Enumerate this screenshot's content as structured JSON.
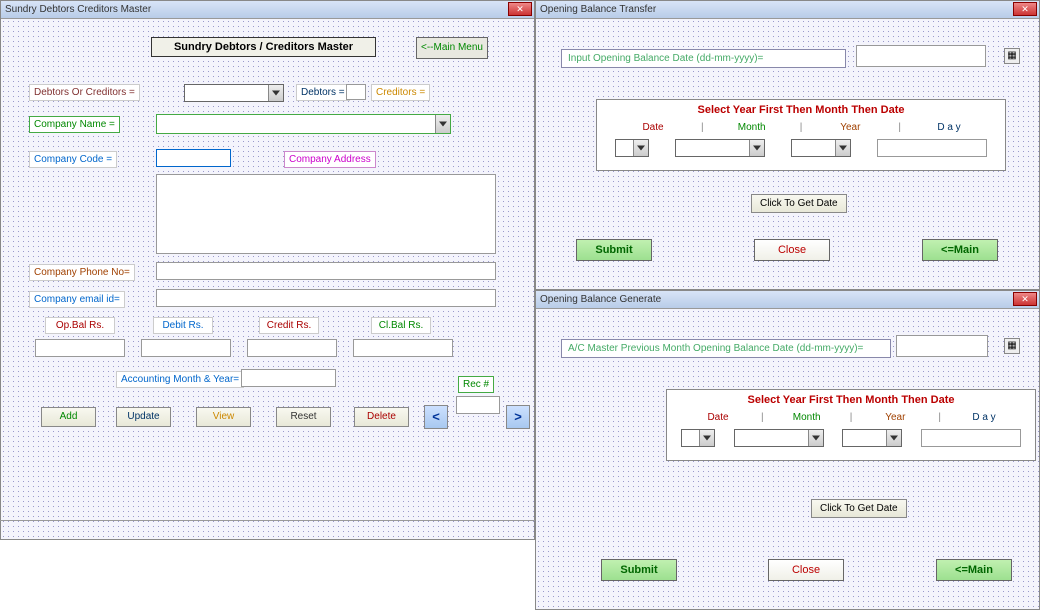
{
  "w1": {
    "title_bar": "Sundry Debtors Creditors  Master",
    "header": "Sundry Debtors / Creditors Master",
    "main_menu": "<--Main Menu",
    "debtors_or_creditors": "Debtors Or Creditors =",
    "debtors": "Debtors =",
    "creditors": "Creditors =",
    "company_name": "Company Name  =",
    "company_code": "Company Code   =",
    "company_address": "Company Address",
    "company_phone": "Company Phone No=",
    "company_email": "Company email id=",
    "opbal": "Op.Bal Rs.",
    "debit": "Debit Rs.",
    "credit": "Credit Rs.",
    "clbal": "Cl.Bal Rs.",
    "acct_month_year": "Accounting Month & Year=",
    "rec": "Rec #",
    "add": "Add",
    "update": "Update",
    "view": "View",
    "reset": "Reset",
    "delete": "Delete",
    "prev": "<",
    "next": ">"
  },
  "w2": {
    "title_bar": "Opening Balance Transfer",
    "prompt": "Input Opening Balance Date (dd-mm-yyyy)=",
    "panel_head": "Select Year First Then Month Then Date",
    "date": "Date",
    "month": "Month",
    "year": "Year",
    "day": "D a y",
    "click_date": "Click To Get Date",
    "submit": "Submit",
    "close": "Close",
    "main": "<=Main"
  },
  "w3": {
    "title_bar": "Opening Balance Generate",
    "prompt": "A/C Master Previous Month Opening Balance Date (dd-mm-yyyy)=",
    "panel_head": "Select Year First Then Month Then Date",
    "date": "Date",
    "month": "Month",
    "year": "Year",
    "day": "D a y",
    "click_date": "Click To Get Date",
    "submit": "Submit",
    "close": "Close",
    "main": "<=Main"
  }
}
